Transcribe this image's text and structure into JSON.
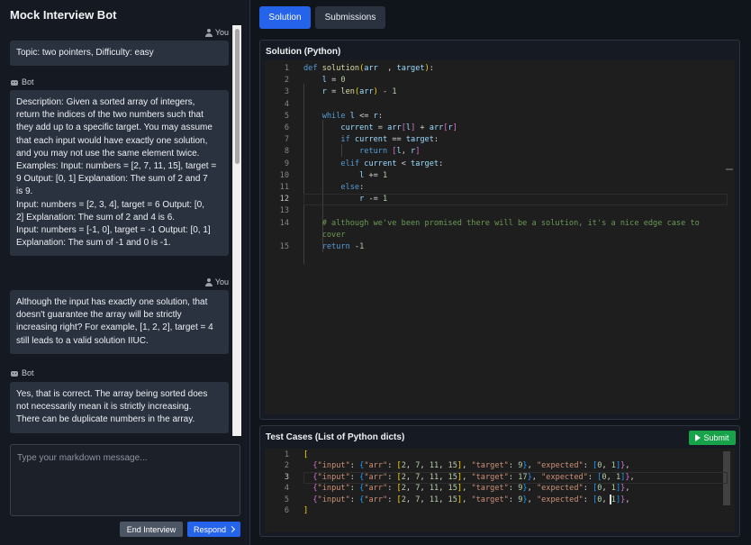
{
  "app": {
    "title": "Mock Interview Bot"
  },
  "chat": {
    "messages": [
      {
        "sender": "You",
        "lines": [
          "Topic: two pointers, Difficulty: easy"
        ]
      },
      {
        "sender": "Bot",
        "lines": [
          "Description: Given a sorted array of integers,",
          "return the indices of the two numbers such that",
          "they add up to a specific target. You may assume",
          "that each input would have exactly one solution,",
          "and you may not use the same element twice.",
          "Examples: Input: numbers = [2, 7, 11, 15], target =",
          "9 Output: [0, 1] Explanation: The sum of 2 and 7",
          "is 9.",
          "Input: numbers = [2, 3, 4], target = 6 Output: [0,",
          "2] Explanation: The sum of 2 and 4 is 6.",
          "Input: numbers = [-1, 0], target = -1 Output: [0, 1]",
          "Explanation: The sum of -1 and 0 is -1."
        ]
      },
      {
        "sender": "You",
        "lines": [
          "Although the input has exactly one solution, that",
          "doesn't guarantee the array will be strictly",
          "increasing right? For example, [1, 2, 2], target = 4",
          "still leads to a valid solution IIUC."
        ]
      },
      {
        "sender": "Bot",
        "lines": [
          "Yes, that is correct. The array being sorted does",
          "not necessarily mean it is strictly increasing.",
          "There can be duplicate numbers in the array."
        ]
      }
    ],
    "input_placeholder": "Type your markdown message...",
    "end_label": "End Interview",
    "respond_label": "Respond"
  },
  "tabs": {
    "solution": "Solution",
    "submissions": "Submissions"
  },
  "solution": {
    "title": "Solution (Python)",
    "active_line": 12,
    "lines": [
      {
        "n": "1",
        "t": [
          [
            "kw",
            "def "
          ],
          [
            "fn",
            "solution"
          ],
          [
            "br",
            "("
          ],
          [
            "var",
            "arr"
          ],
          [
            "",
            "  , "
          ],
          [
            "var",
            "target"
          ],
          [
            "br",
            ")"
          ],
          [
            "",
            ":"
          ]
        ]
      },
      {
        "n": "2",
        "t": [
          [
            "",
            "    "
          ],
          [
            "var",
            "l"
          ],
          [
            "",
            " = "
          ],
          [
            "num",
            "0"
          ]
        ]
      },
      {
        "n": "3",
        "t": [
          [
            "",
            "    "
          ],
          [
            "var",
            "r"
          ],
          [
            "",
            " = "
          ],
          [
            "fn",
            "len"
          ],
          [
            "br",
            "("
          ],
          [
            "var",
            "arr"
          ],
          [
            "br",
            ")"
          ],
          [
            "",
            " - "
          ],
          [
            "num",
            "1"
          ]
        ]
      },
      {
        "n": "4",
        "t": []
      },
      {
        "n": "5",
        "t": [
          [
            "",
            "    "
          ],
          [
            "kw",
            "while "
          ],
          [
            "var",
            "l"
          ],
          [
            "",
            " <= "
          ],
          [
            "var",
            "r"
          ],
          [
            "",
            ":"
          ]
        ]
      },
      {
        "n": "6",
        "t": [
          [
            "",
            "        "
          ],
          [
            "var",
            "current"
          ],
          [
            "",
            " = "
          ],
          [
            "var",
            "arr"
          ],
          [
            "br2",
            "["
          ],
          [
            "var",
            "l"
          ],
          [
            "br2",
            "]"
          ],
          [
            "",
            " + "
          ],
          [
            "var",
            "arr"
          ],
          [
            "br2",
            "["
          ],
          [
            "var",
            "r"
          ],
          [
            "br2",
            "]"
          ]
        ]
      },
      {
        "n": "7",
        "t": [
          [
            "",
            "        "
          ],
          [
            "kw",
            "if "
          ],
          [
            "var",
            "current"
          ],
          [
            "",
            " == "
          ],
          [
            "var",
            "target"
          ],
          [
            "",
            ":"
          ]
        ]
      },
      {
        "n": "8",
        "t": [
          [
            "",
            "            "
          ],
          [
            "kw",
            "return "
          ],
          [
            "br2",
            "["
          ],
          [
            "var",
            "l"
          ],
          [
            "",
            ", "
          ],
          [
            "var",
            "r"
          ],
          [
            "br2",
            "]"
          ]
        ]
      },
      {
        "n": "9",
        "t": [
          [
            "",
            "        "
          ],
          [
            "kw",
            "elif "
          ],
          [
            "var",
            "current"
          ],
          [
            "",
            " < "
          ],
          [
            "var",
            "target"
          ],
          [
            "",
            ":"
          ]
        ]
      },
      {
        "n": "10",
        "t": [
          [
            "",
            "            "
          ],
          [
            "var",
            "l"
          ],
          [
            "",
            " += "
          ],
          [
            "num",
            "1"
          ]
        ]
      },
      {
        "n": "11",
        "t": [
          [
            "",
            "        "
          ],
          [
            "kw",
            "else"
          ],
          [
            "",
            ":"
          ]
        ]
      },
      {
        "n": "12",
        "t": [
          [
            "",
            "            "
          ],
          [
            "var",
            "r"
          ],
          [
            "",
            " -= "
          ],
          [
            "num",
            "1"
          ]
        ]
      },
      {
        "n": "13",
        "t": []
      },
      {
        "n": "14",
        "t": [
          [
            "",
            "    "
          ],
          [
            "cmt",
            "# although we've been promised there will be a solution, it's a nice edge case to"
          ]
        ]
      },
      {
        "n": "",
        "t": [
          [
            "",
            "    "
          ],
          [
            "cmt",
            "cover"
          ]
        ]
      },
      {
        "n": "15",
        "t": [
          [
            "",
            "    "
          ],
          [
            "kw",
            "return "
          ],
          [
            "",
            "-"
          ],
          [
            "num",
            "1"
          ]
        ]
      }
    ]
  },
  "tests": {
    "title": "Test Cases (List of Python dicts)",
    "submit_label": "Submit",
    "active_line": 3,
    "lines": [
      {
        "n": "1",
        "t": [
          [
            "br",
            "["
          ]
        ]
      },
      {
        "n": "2",
        "t": [
          [
            "",
            "  "
          ],
          [
            "br2",
            "{"
          ],
          [
            "str",
            "\"input\""
          ],
          [
            ": "
          ],
          [
            "br3",
            "{"
          ],
          [
            "str",
            "\"arr\""
          ],
          [
            ": "
          ],
          [
            "br",
            "["
          ],
          [
            "num",
            "2"
          ],
          [
            ", "
          ],
          [
            "num",
            "7"
          ],
          [
            ", "
          ],
          [
            "num",
            "11"
          ],
          [
            ", "
          ],
          [
            "num",
            "15"
          ],
          [
            "br",
            "]"
          ],
          [
            ", "
          ],
          [
            "str",
            "\"target\""
          ],
          [
            ": "
          ],
          [
            "num",
            "9"
          ],
          [
            "br3",
            "}"
          ],
          [
            ", "
          ],
          [
            "str",
            "\"expected\""
          ],
          [
            ": "
          ],
          [
            "br3",
            "["
          ],
          [
            "num",
            "0"
          ],
          [
            ", "
          ],
          [
            "num",
            "1"
          ],
          [
            "br3",
            "]"
          ],
          [
            "br2",
            "}"
          ],
          [
            ","
          ]
        ]
      },
      {
        "n": "3",
        "t": [
          [
            "",
            "  "
          ],
          [
            "br2",
            "{"
          ],
          [
            "str",
            "\"input\""
          ],
          [
            ": "
          ],
          [
            "br3",
            "{"
          ],
          [
            "str",
            "\"arr\""
          ],
          [
            ": "
          ],
          [
            "br",
            "["
          ],
          [
            "num",
            "2"
          ],
          [
            ", "
          ],
          [
            "num",
            "7"
          ],
          [
            ", "
          ],
          [
            "num",
            "11"
          ],
          [
            ", "
          ],
          [
            "num",
            "15"
          ],
          [
            "br",
            "]"
          ],
          [
            ", "
          ],
          [
            "str",
            "\"target\""
          ],
          [
            ": "
          ],
          [
            "num",
            "17"
          ],
          [
            "br3",
            "}"
          ],
          [
            ", "
          ],
          [
            "str",
            "\"expected\""
          ],
          [
            ": "
          ],
          [
            "br3",
            "["
          ],
          [
            "num",
            "0"
          ],
          [
            ", "
          ],
          [
            "num",
            "1"
          ],
          [
            "br3",
            "]"
          ],
          [
            "br2",
            "}"
          ],
          [
            ","
          ]
        ]
      },
      {
        "n": "4",
        "t": [
          [
            "",
            "  "
          ],
          [
            "br2",
            "{"
          ],
          [
            "str",
            "\"input\""
          ],
          [
            ": "
          ],
          [
            "br3",
            "{"
          ],
          [
            "str",
            "\"arr\""
          ],
          [
            ": "
          ],
          [
            "br",
            "["
          ],
          [
            "num",
            "2"
          ],
          [
            ", "
          ],
          [
            "num",
            "7"
          ],
          [
            ", "
          ],
          [
            "num",
            "11"
          ],
          [
            ", "
          ],
          [
            "num",
            "15"
          ],
          [
            "br",
            "]"
          ],
          [
            ", "
          ],
          [
            "str",
            "\"target\""
          ],
          [
            ": "
          ],
          [
            "num",
            "9"
          ],
          [
            "br3",
            "}"
          ],
          [
            ", "
          ],
          [
            "str",
            "\"expected\""
          ],
          [
            ": "
          ],
          [
            "br3",
            "["
          ],
          [
            "num",
            "0"
          ],
          [
            ", "
          ],
          [
            "num",
            "1"
          ],
          [
            "br3",
            "]"
          ],
          [
            "br2",
            "}"
          ],
          [
            ","
          ]
        ]
      },
      {
        "n": "5",
        "t": [
          [
            "",
            "  "
          ],
          [
            "br2",
            "{"
          ],
          [
            "str",
            "\"input\""
          ],
          [
            ": "
          ],
          [
            "br3",
            "{"
          ],
          [
            "str",
            "\"arr\""
          ],
          [
            ": "
          ],
          [
            "br",
            "["
          ],
          [
            "num",
            "2"
          ],
          [
            ", "
          ],
          [
            "num",
            "7"
          ],
          [
            ", "
          ],
          [
            "num",
            "11"
          ],
          [
            ", "
          ],
          [
            "num",
            "15"
          ],
          [
            "br",
            "]"
          ],
          [
            ", "
          ],
          [
            "str",
            "\"target\""
          ],
          [
            ": "
          ],
          [
            "num",
            "9"
          ],
          [
            "br3",
            "}"
          ],
          [
            ", "
          ],
          [
            "str",
            "\"expected\""
          ],
          [
            ": "
          ],
          [
            "br3",
            "["
          ],
          [
            "num",
            "0"
          ],
          [
            ", "
          ],
          [
            "num",
            "1"
          ],
          [
            "br3",
            "]"
          ],
          [
            "br2",
            "}"
          ],
          [
            ","
          ]
        ]
      },
      {
        "n": "6",
        "t": [
          [
            "br",
            "]"
          ]
        ]
      }
    ]
  }
}
